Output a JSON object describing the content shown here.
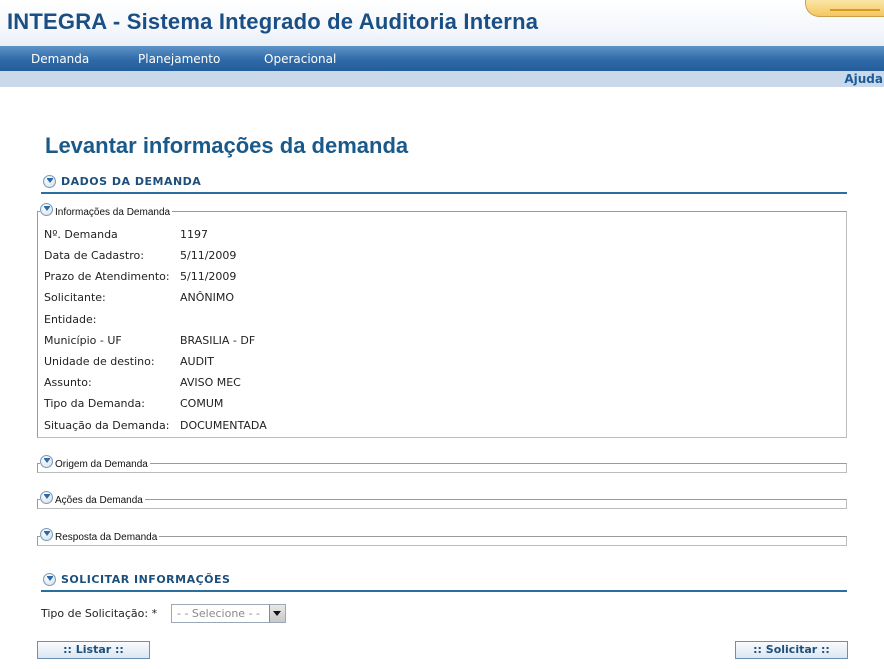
{
  "header": {
    "title": "INTEGRA - Sistema Integrado de Auditoria Interna"
  },
  "nav": {
    "items": [
      "Demanda",
      "Planejamento",
      "Operacional"
    ],
    "help": "Ajuda"
  },
  "page": {
    "title": "Levantar informações da demanda"
  },
  "dados_section": {
    "label": "DADOS DA DEMANDA"
  },
  "info_fieldset": {
    "legend": "Informações da Demanda",
    "rows": [
      {
        "label": "Nº. Demanda",
        "value": "1197"
      },
      {
        "label": "Data de Cadastro:",
        "value": "5/11/2009"
      },
      {
        "label": "Prazo de Atendimento:",
        "value": "5/11/2009"
      },
      {
        "label": "Solicitante:",
        "value": "ANÔNIMO"
      },
      {
        "label": "Entidade:",
        "value": ""
      },
      {
        "label": "Município - UF",
        "value": "BRASILIA - DF"
      },
      {
        "label": "Unidade de destino:",
        "value": "AUDIT"
      },
      {
        "label": "Assunto:",
        "value": "AVISO MEC"
      },
      {
        "label": "Tipo da Demanda:",
        "value": "COMUM"
      },
      {
        "label": "Situação da Demanda:",
        "value": "DOCUMENTADA"
      }
    ]
  },
  "collapsed_fieldsets": [
    "Origem da Demanda",
    "Ações da Demanda",
    "Resposta da Demanda"
  ],
  "solicitar_section": {
    "label": "SOLICITAR INFORMAÇÕES"
  },
  "form": {
    "tipo_label": "Tipo de Solicitação: *",
    "tipo_value": "- - Selecione - -"
  },
  "buttons": {
    "listar": ":: Listar ::",
    "solicitar": ":: Solicitar ::"
  }
}
